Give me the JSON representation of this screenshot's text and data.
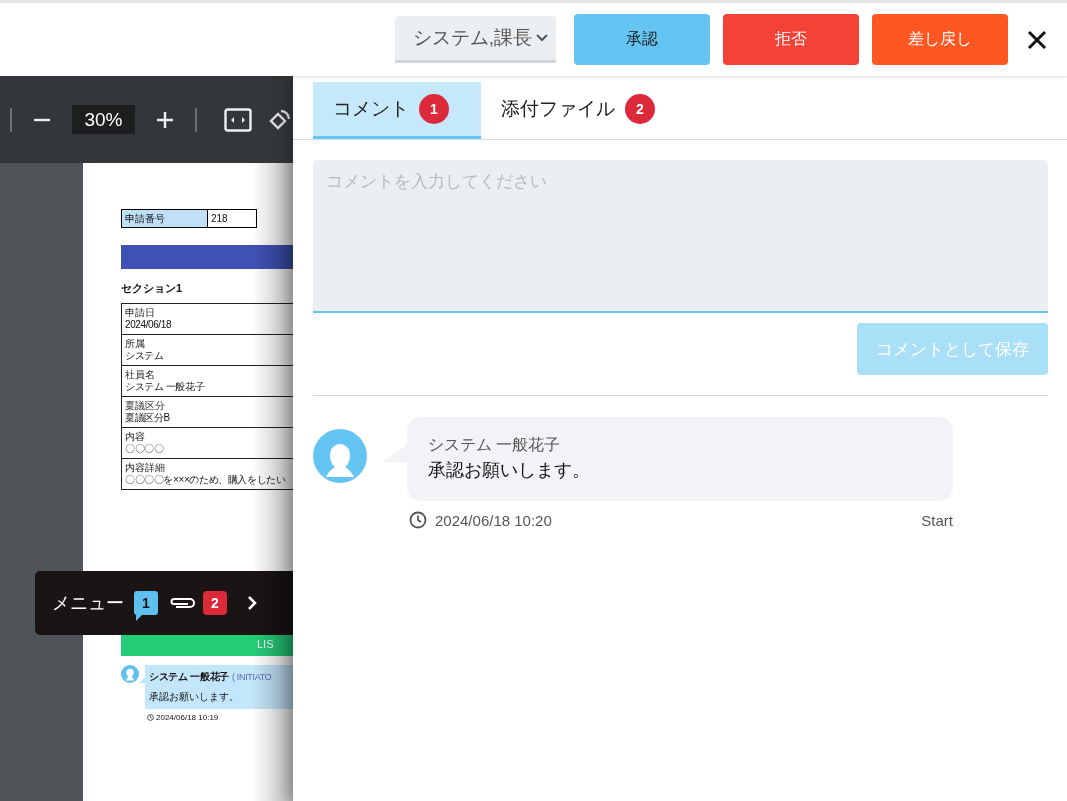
{
  "header": {
    "role_select": {
      "value": "システム,課長"
    },
    "buttons": [
      {
        "label": "承認",
        "kind": "approve"
      },
      {
        "label": "拒否",
        "kind": "reject"
      },
      {
        "label": "差し戻し",
        "kind": "return"
      }
    ]
  },
  "viewer": {
    "zoom": "30%",
    "document": {
      "application_number": {
        "label": "申請番号",
        "value": "218"
      },
      "section_title": "セクション1",
      "fields": [
        {
          "label": "申請日",
          "value": "2024/06/18"
        },
        {
          "label": "所属",
          "value": "システム"
        },
        {
          "label": "社員名",
          "value": "システム 一般花子"
        },
        {
          "label": "稟議区分",
          "value": "稟議区分B"
        },
        {
          "label": "内容",
          "value": "〇〇〇〇"
        },
        {
          "label": "内容詳細",
          "value": "〇〇〇〇を×××のため、購入をしたい"
        }
      ],
      "history_banner": "LIS",
      "history": [
        {
          "author": "システム 一般花子",
          "role": "( INITIATO",
          "message": "承認お願いします。",
          "time": "2024/06/18 10:19"
        }
      ]
    }
  },
  "menu": {
    "label": "メニュー",
    "comment_count": "1",
    "attachment_count": "2"
  },
  "panel": {
    "tabs": [
      {
        "label": "コメント",
        "count": "1",
        "selected": true
      },
      {
        "label": "添付ファイル",
        "count": "2",
        "selected": false
      }
    ],
    "comment_input": {
      "placeholder": "コメントを入力してください"
    },
    "save_button": {
      "label": "コメントとして保存",
      "disabled": true
    },
    "comments": [
      {
        "author": "システム 一般花子",
        "message": "承認お願いします。",
        "time": "2024/06/18 10:20",
        "status": "Start"
      }
    ]
  }
}
